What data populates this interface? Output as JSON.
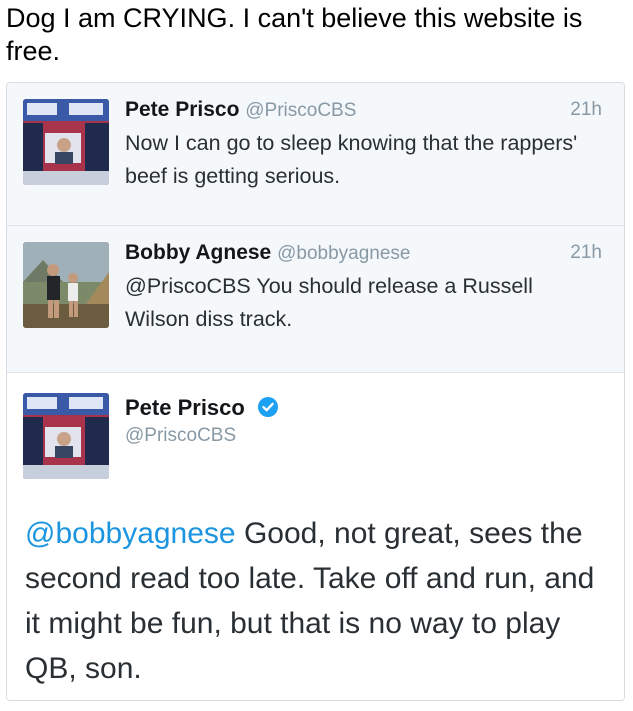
{
  "caption": "Dog I am CRYING. I can't believe this website is free.",
  "tweets": [
    {
      "name": "Pete Prisco",
      "handle": "@PriscoCBS",
      "time": "21h",
      "text": "Now I can go to sleep knowing that the rappers' beef is getting serious."
    },
    {
      "name": "Bobby Agnese",
      "handle": "@bobbyagnese",
      "time": "21h",
      "text": "@PriscoCBS You should release a Russell Wilson diss track."
    }
  ],
  "main_tweet": {
    "name": "Pete Prisco",
    "handle": "@PriscoCBS",
    "mention": "@bobbyagnese",
    "text": " Good, not great, sees the second read too late. Take off and run, and it might be fun, but that is no way to play QB, son."
  },
  "colors": {
    "link": "#1b95e0",
    "verified": "#1da1f2",
    "reply_background": "#f5f8fa",
    "muted_text": "#8899a6"
  },
  "icons": {
    "verified": "verified-badge-icon"
  }
}
